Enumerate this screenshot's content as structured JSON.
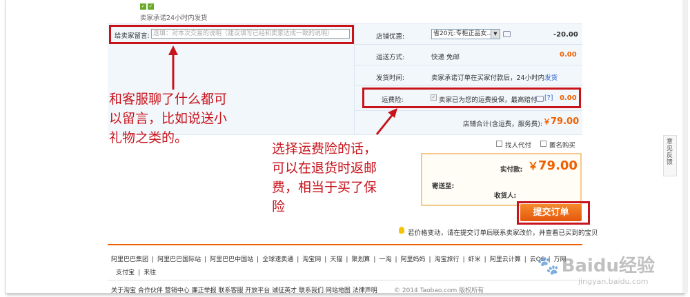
{
  "top": {
    "shipping_promise": "卖家承诺24小时内发货"
  },
  "message": {
    "label": "给卖家留言:",
    "placeholder": "选填：对本次交易的说明（建议填写已经和卖家达成一致的说明）"
  },
  "shop_discount": {
    "label": "店铺优惠:",
    "selected": "省20元:专柜正品女...",
    "amount": "-20.00"
  },
  "shipping": {
    "label": "运送方式:",
    "value": "快递 免邮",
    "amount": "0.00"
  },
  "delivery_time": {
    "label": "发货时间:",
    "value_prefix": "卖家承诺订单在买家付款后，24小时内",
    "value_link": "发货"
  },
  "insurance": {
    "label": "运费险:",
    "value": "卖家已为您的运费投保，最高赔付...",
    "help": "[?]",
    "amount": "0.00"
  },
  "shop_total": {
    "label": "店铺合计(含运费，服务费):",
    "currency": "￥",
    "amount": "79.00"
  },
  "options": {
    "proxy_pay": "找人代付",
    "anonymous": "匿名购买"
  },
  "summary": {
    "paid_label": "实付款:",
    "currency": "￥",
    "paid_amount": "79.00",
    "ship_to_label": "寄送至:",
    "receiver_label": "收货人:"
  },
  "submit_label": "提交订单",
  "price_tip": "若价格变动，请在提交订单后联系卖家改价，并查看已买到的宝贝",
  "side_feedback": "意见反馈",
  "annotations": {
    "left": [
      "和客服聊了什么都可",
      "以留言，比如说送小",
      "礼物之类的。"
    ],
    "right": [
      "选择运费险的话，",
      "可以在退货时返邮",
      "费，相当于买了保",
      "险"
    ]
  },
  "footer": {
    "row1": [
      "阿里巴巴集团",
      "阿里巴巴国际站",
      "阿里巴巴中国站",
      "全球速卖通",
      "淘宝网",
      "天猫",
      "聚划算",
      "一淘",
      "阿里妈妈",
      "淘宝旅行",
      "虾米",
      "阿里云计算",
      "云OS",
      "万网"
    ],
    "row2": [
      "支付宝",
      "来往"
    ],
    "row3": "关于淘宝 合作伙伴 营销中心 廉正举报 联系客服 开放平台 诚征英才 联系我们 网站地图 法律声明",
    "copyright": "© 2014 Taobao.com 版权所有"
  },
  "watermark": {
    "brand": "Baidu经验",
    "url": "jingyan.baidu.com"
  },
  "colors": {
    "annotation_red": "#c8131b",
    "price_orange": "#f06000",
    "panel_bg": "#f2f7fb",
    "submit_orange": "#f0701a"
  }
}
